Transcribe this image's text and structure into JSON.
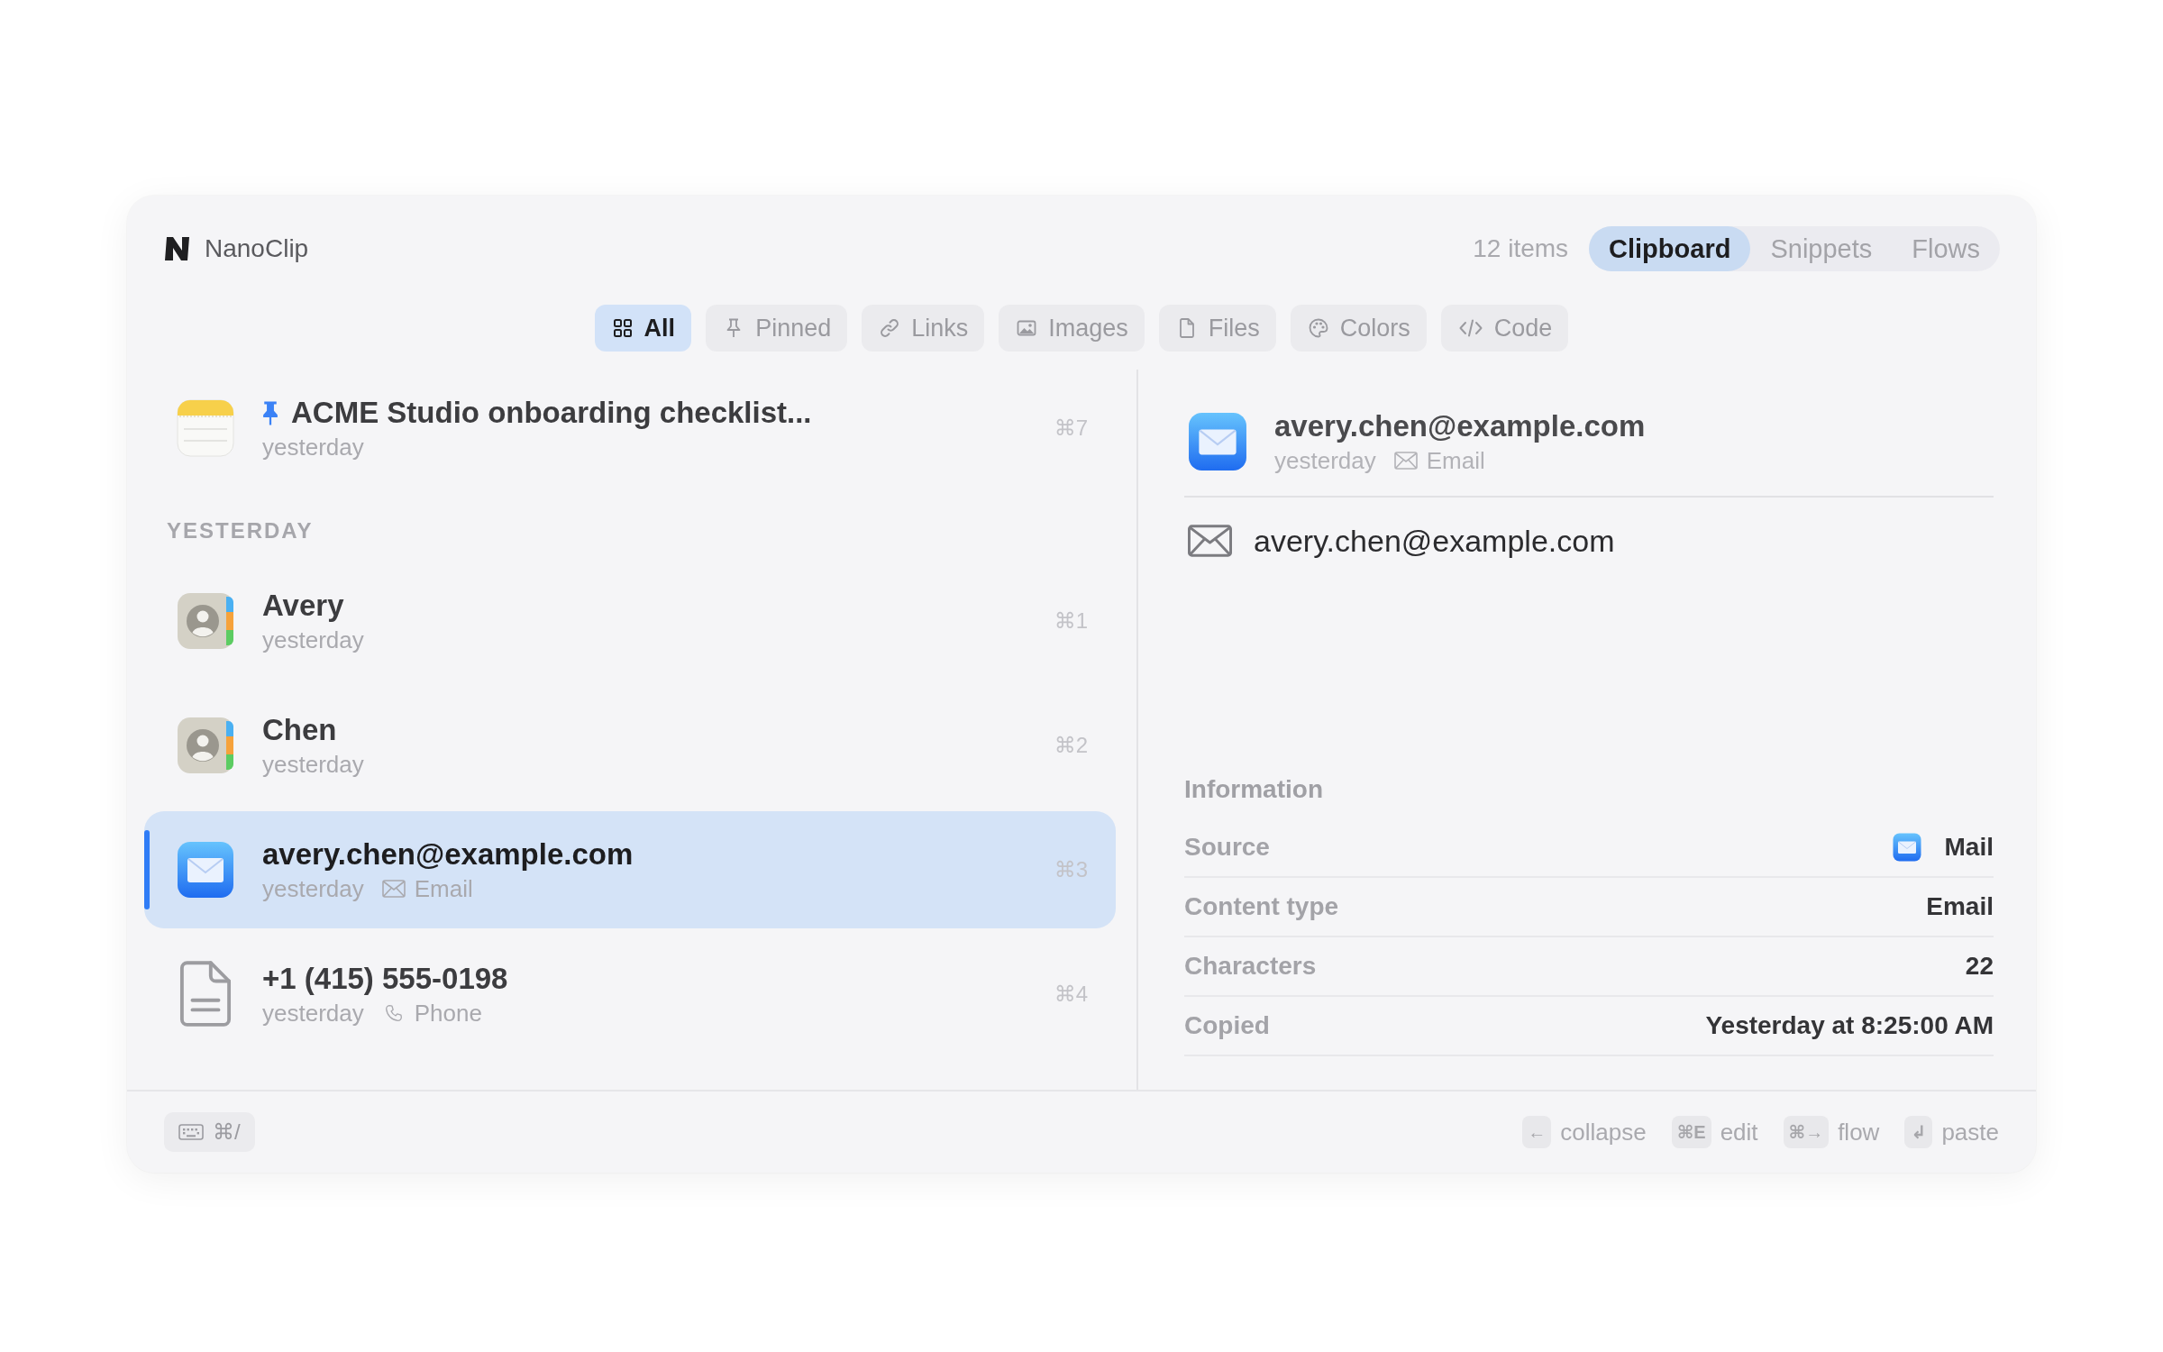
{
  "app": {
    "name": "NanoClip"
  },
  "header": {
    "count": "12 items",
    "modes": [
      {
        "label": "Clipboard",
        "selected": true
      },
      {
        "label": "Snippets",
        "selected": false
      },
      {
        "label": "Flows",
        "selected": false
      }
    ]
  },
  "filters": [
    {
      "kind": "all",
      "label": "All",
      "selected": true
    },
    {
      "kind": "pinned",
      "label": "Pinned",
      "selected": false
    },
    {
      "kind": "links",
      "label": "Links",
      "selected": false
    },
    {
      "kind": "images",
      "label": "Images",
      "selected": false
    },
    {
      "kind": "files",
      "label": "Files",
      "selected": false
    },
    {
      "kind": "colors",
      "label": "Colors",
      "selected": false
    },
    {
      "kind": "code",
      "label": "Code",
      "selected": false
    }
  ],
  "list": {
    "pinned": [
      {
        "kind": "note",
        "title": "ACME Studio onboarding checklist...",
        "pinned": true,
        "time": "yesterday",
        "shortcut": "⌘7",
        "selected": false
      }
    ],
    "sections": [
      {
        "heading": "YESTERDAY",
        "items": [
          {
            "kind": "contact",
            "title": "Avery",
            "pinned": false,
            "time": "yesterday",
            "shortcut": "⌘1",
            "selected": false
          },
          {
            "kind": "contact",
            "title": "Chen",
            "pinned": false,
            "time": "yesterday",
            "shortcut": "⌘2",
            "selected": false
          },
          {
            "kind": "mail",
            "title": "avery.chen@example.com",
            "pinned": false,
            "time": "yesterday",
            "type": {
              "kind": "email",
              "label": "Email"
            },
            "shortcut": "⌘3",
            "selected": true
          },
          {
            "kind": "document",
            "title": "+1 (415) 555-0198",
            "pinned": false,
            "time": "yesterday",
            "type": {
              "kind": "phone",
              "label": "Phone"
            },
            "shortcut": "⌘4",
            "selected": false
          }
        ]
      }
    ]
  },
  "detail": {
    "kind": "mail",
    "title": "avery.chen@example.com",
    "time": "yesterday",
    "type": {
      "kind": "email",
      "label": "Email"
    },
    "content": {
      "kind": "email",
      "text": "avery.chen@example.com"
    },
    "info": {
      "heading": "Information",
      "rows": [
        {
          "kind": "app",
          "label": "Source",
          "value": "Mail"
        },
        {
          "kind": "text",
          "label": "Content type",
          "value": "Email"
        },
        {
          "kind": "text",
          "label": "Characters",
          "value": "22"
        },
        {
          "kind": "text",
          "label": "Copied",
          "value": "Yesterday at 8:25:00 AM"
        }
      ]
    }
  },
  "footer": {
    "keyboard_button": {
      "keys": "⌘/"
    },
    "hints": [
      {
        "keys": "←",
        "label": "collapse"
      },
      {
        "keys": "⌘E",
        "label": "edit"
      },
      {
        "keys": "⌘→",
        "label": "flow"
      },
      {
        "keys": "↲",
        "label": "paste"
      }
    ]
  }
}
